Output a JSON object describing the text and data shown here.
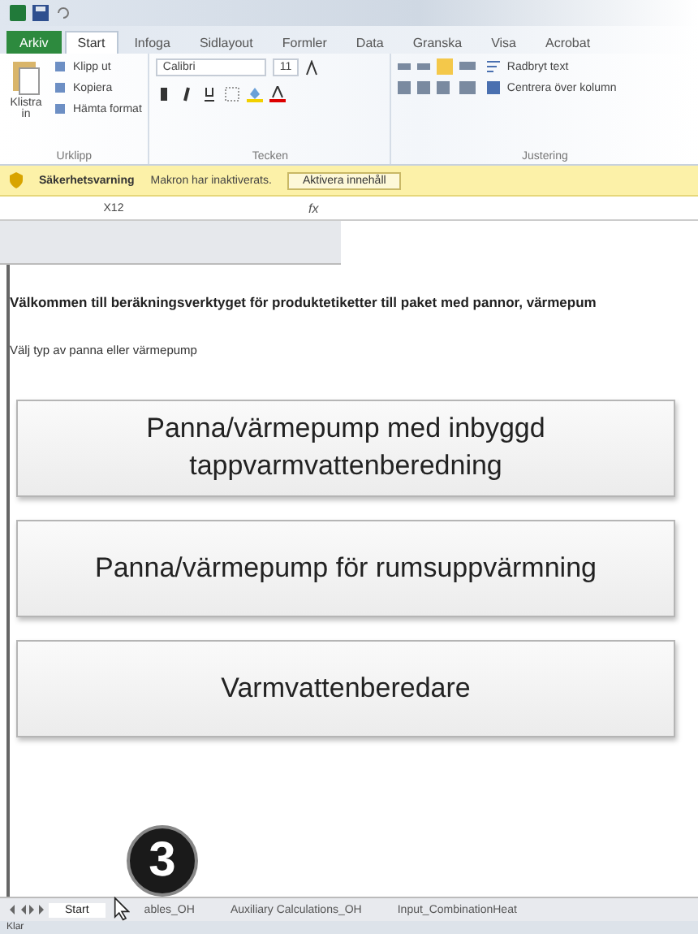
{
  "ribbon_tabs": [
    {
      "label": "Arkiv",
      "kind": "file",
      "selected": false
    },
    {
      "label": "Start",
      "kind": "tab",
      "selected": true
    },
    {
      "label": "Infoga",
      "kind": "tab",
      "selected": false
    },
    {
      "label": "Sidlayout",
      "kind": "tab",
      "selected": false
    },
    {
      "label": "Formler",
      "kind": "tab",
      "selected": false
    },
    {
      "label": "Data",
      "kind": "tab",
      "selected": false
    },
    {
      "label": "Granska",
      "kind": "tab",
      "selected": false
    },
    {
      "label": "Visa",
      "kind": "tab",
      "selected": false
    },
    {
      "label": "Acrobat",
      "kind": "tab",
      "selected": false
    }
  ],
  "clipboard": {
    "paste": "Klistra in",
    "items": [
      "Klipp ut",
      "Kopiera",
      "Hämta format"
    ],
    "group": "Urklipp"
  },
  "font": {
    "name": "Calibri",
    "size": "11",
    "group": "Tecken"
  },
  "alignment": {
    "wrap": "Radbryt text",
    "merge": "Centrera över kolumn",
    "group": "Justering"
  },
  "security_bar": {
    "title": "Säkerhetsvarning",
    "message": "Makron har inaktiverats.",
    "button": "Aktivera innehåll"
  },
  "formula_bar": {
    "name_box": "X12",
    "function_label": "fx"
  },
  "sheet": {
    "title": "Välkommen till beräkningsverktyget för produktetiketter till paket med pannor, värmepum",
    "prompt": "Välj typ av panna eller värmepump",
    "buttons": [
      "Panna/värmepump med inbyggd tappvarmvattenberedning",
      "Panna/värmepump för rumsuppvärmning",
      "Varmvattenberedare"
    ]
  },
  "sheet_tabs": [
    {
      "label": "Start",
      "selected": true
    },
    {
      "label": "ables_OH",
      "selected": false
    },
    {
      "label": "Auxiliary Calculations_OH",
      "selected": false
    },
    {
      "label": "Input_CombinationHeat",
      "selected": false
    }
  ],
  "step_badge": "3",
  "status_bar": {
    "text": "Klar"
  }
}
